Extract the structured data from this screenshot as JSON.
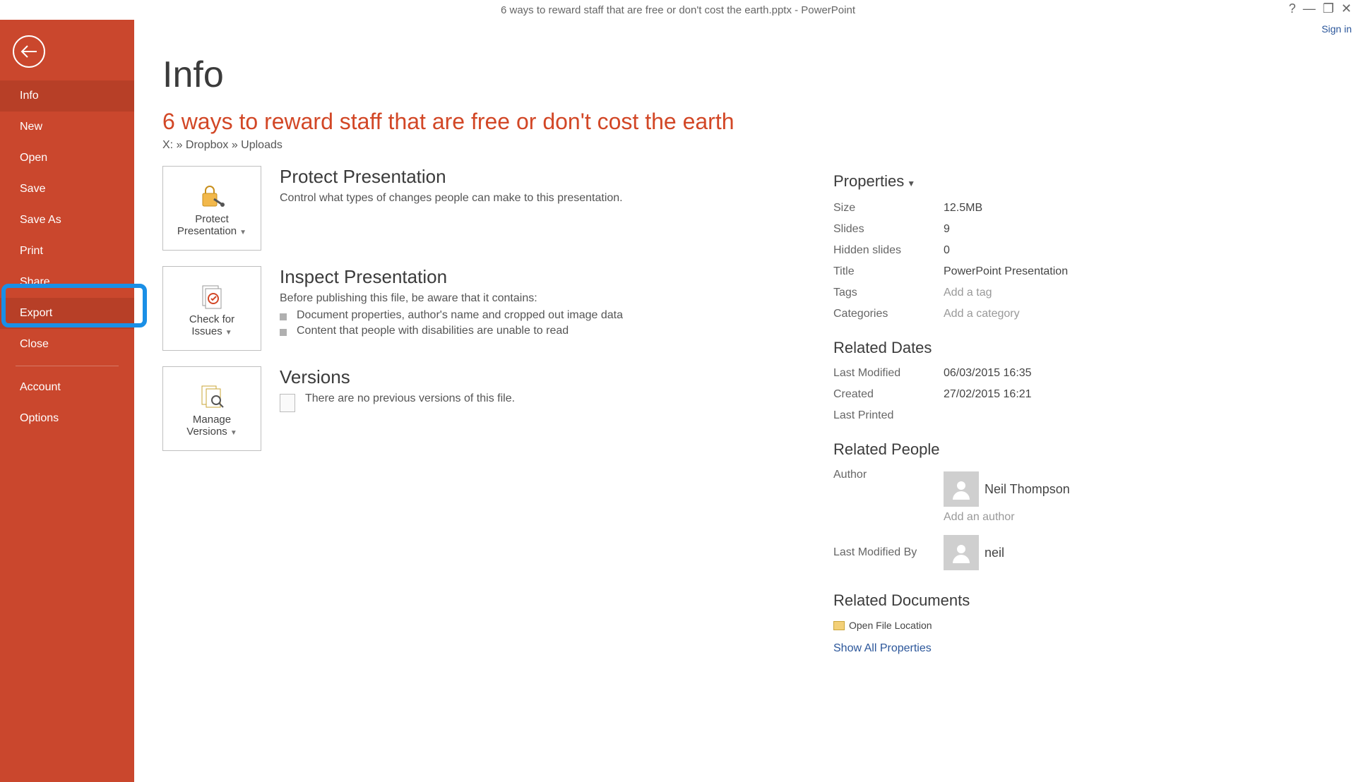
{
  "window": {
    "title": "6 ways to reward staff that are free or don't cost the earth.pptx - PowerPoint",
    "sign_in": "Sign in"
  },
  "sidebar": {
    "items": [
      {
        "label": "Info",
        "selected": true
      },
      {
        "label": "New"
      },
      {
        "label": "Open"
      },
      {
        "label": "Save"
      },
      {
        "label": "Save As"
      },
      {
        "label": "Print"
      },
      {
        "label": "Share"
      },
      {
        "label": "Export",
        "highlighted": true
      },
      {
        "label": "Close"
      }
    ],
    "items2": [
      {
        "label": "Account"
      },
      {
        "label": "Options"
      }
    ]
  },
  "page": {
    "title": "Info",
    "doc_title": "6 ways to reward staff that are free or don't cost the earth",
    "doc_path": "X: » Dropbox » Uploads"
  },
  "protect": {
    "button_line1": "Protect",
    "button_line2": "Presentation",
    "heading": "Protect Presentation",
    "desc": "Control what types of changes people can make to this presentation."
  },
  "inspect": {
    "button_line1": "Check for",
    "button_line2": "Issues",
    "heading": "Inspect Presentation",
    "desc": "Before publishing this file, be aware that it contains:",
    "bullets": [
      "Document properties, author's name and cropped out image data",
      "Content that people with disabilities are unable to read"
    ]
  },
  "versions": {
    "button_line1": "Manage",
    "button_line2": "Versions",
    "heading": "Versions",
    "desc": "There are no previous versions of this file."
  },
  "properties": {
    "header": "Properties",
    "rows": [
      {
        "label": "Size",
        "value": "12.5MB"
      },
      {
        "label": "Slides",
        "value": "9"
      },
      {
        "label": "Hidden slides",
        "value": "0"
      },
      {
        "label": "Title",
        "value": "PowerPoint Presentation"
      },
      {
        "label": "Tags",
        "placeholder": "Add a tag"
      },
      {
        "label": "Categories",
        "placeholder": "Add a category"
      }
    ],
    "dates_header": "Related Dates",
    "dates": [
      {
        "label": "Last Modified",
        "value": "06/03/2015 16:35"
      },
      {
        "label": "Created",
        "value": "27/02/2015 16:21"
      },
      {
        "label": "Last Printed",
        "value": ""
      }
    ],
    "people_header": "Related People",
    "author_label": "Author",
    "author_name": "Neil Thompson",
    "add_author": "Add an author",
    "modified_by_label": "Last Modified By",
    "modified_by_name": "neil",
    "docs_header": "Related Documents",
    "open_location": "Open File Location",
    "show_all": "Show All Properties"
  }
}
